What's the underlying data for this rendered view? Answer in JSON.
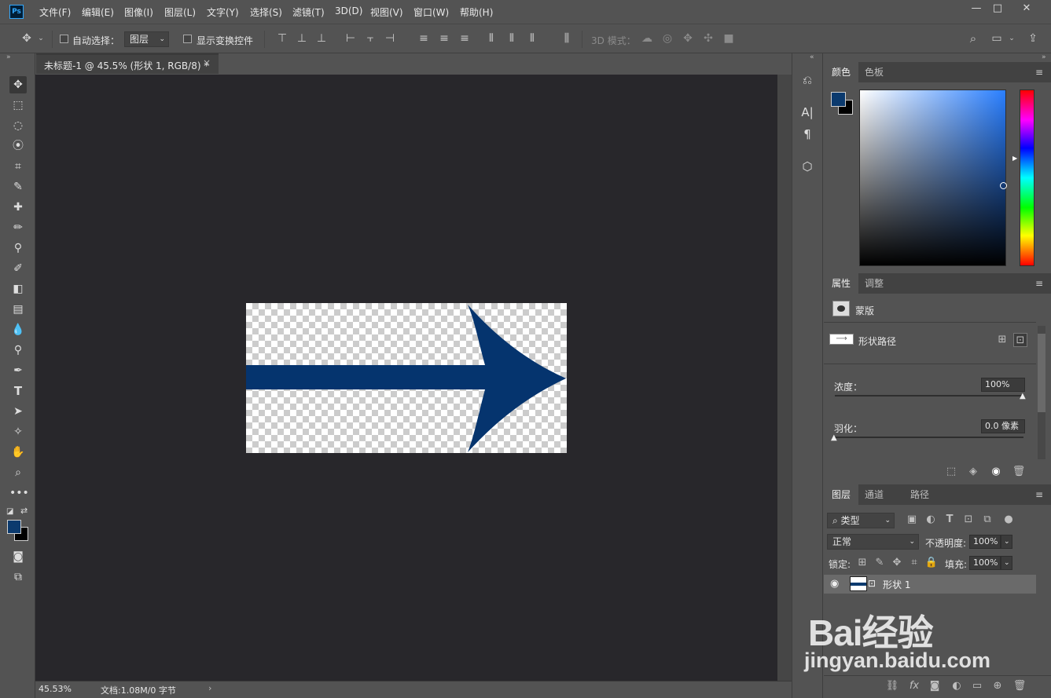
{
  "app": {
    "logo": "Ps"
  },
  "menu": [
    "文件(F)",
    "编辑(E)",
    "图像(I)",
    "图层(L)",
    "文字(Y)",
    "选择(S)",
    "滤镜(T)",
    "3D(D)",
    "视图(V)",
    "窗口(W)",
    "帮助(H)"
  ],
  "window_controls": {
    "minimize": "—",
    "maximize": "□",
    "close": "✕"
  },
  "options": {
    "auto_select_label": "自动选择：",
    "auto_select_value": "图层",
    "show_transform_label": "显示变换控件",
    "mode_3d_label": "3D 模式："
  },
  "document": {
    "tab_title": "未标题-1 @ 45.5% (形状 1, RGB/8) *",
    "close": "×",
    "zoom": "45.53%",
    "doc_info": "文档:1.08M/0 字节",
    "status_arrow": "›",
    "arrow_color": "#05346e"
  },
  "color_panel": {
    "tabs": [
      "颜色",
      "色板"
    ],
    "foreground": "#0b3a6e",
    "background": "#000000"
  },
  "properties_panel": {
    "tabs": [
      "属性",
      "调整"
    ],
    "mask_label": "蒙版",
    "shape_path_label": "形状路径",
    "density_label": "浓度：",
    "density_value": "100%",
    "density_fraction": 1.0,
    "feather_label": "羽化：",
    "feather_value": "0.0 像素",
    "feather_fraction": 0.0
  },
  "layers_panel": {
    "tabs": [
      "图层",
      "通道",
      "路径"
    ],
    "filter_value": "类型",
    "blend_mode": "正常",
    "opacity_label": "不透明度:",
    "opacity_value": "100%",
    "lock_label": "锁定:",
    "fill_label": "填充:",
    "fill_value": "100%",
    "layers": [
      {
        "name": "形状 1",
        "visible": true
      }
    ]
  },
  "watermark": {
    "logo": "Bai经验",
    "url": "jingyan.baidu.com"
  }
}
